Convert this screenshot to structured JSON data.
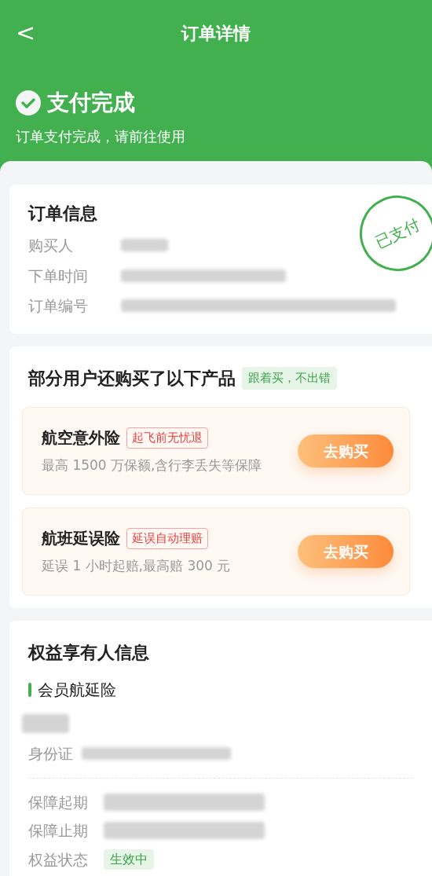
{
  "nav": {
    "back": "<",
    "title": "订单详情"
  },
  "status": {
    "title": "支付完成",
    "subtitle": "订单支付完成，请前往使用"
  },
  "order_info": {
    "title": "订单信息",
    "stamp": "已支付",
    "rows": [
      {
        "label": "购买人"
      },
      {
        "label": "下单时间"
      },
      {
        "label": "订单编号"
      }
    ]
  },
  "recommend": {
    "title": "部分用户还购买了以下产品",
    "tag": "跟着买，不出错",
    "products": [
      {
        "name": "航空意外险",
        "tag": "起飞前无忧退",
        "desc": "最高 1500 万保额,含行李丢失等保障",
        "button": "去购买"
      },
      {
        "name": "航班延误险",
        "tag": "延误自动理赔",
        "desc": "延误 1 小时起赔,最高赔 300 元",
        "button": "去购买"
      }
    ]
  },
  "beneficiary": {
    "title": "权益享有人信息",
    "product": "会员航延险",
    "id_label": "身份证",
    "rows": [
      {
        "label": "保障起期"
      },
      {
        "label": "保障止期"
      }
    ],
    "state_label": "权益状态",
    "state": "生效中"
  }
}
